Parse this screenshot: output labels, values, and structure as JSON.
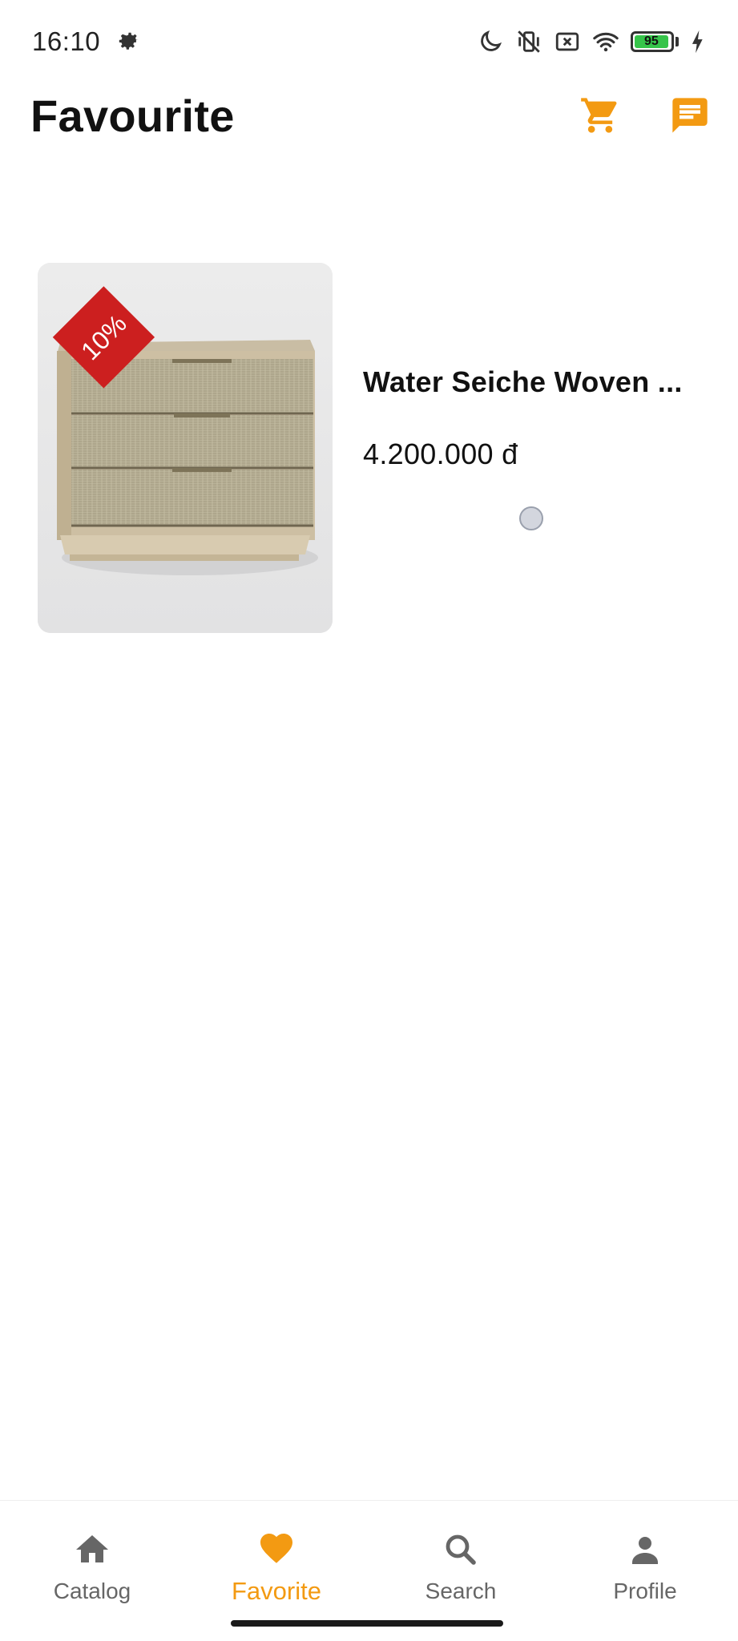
{
  "status_bar": {
    "time": "16:10",
    "battery_level": "95",
    "icons": [
      "gear-icon",
      "moon-icon",
      "vibrate-off-icon",
      "sim-off-icon",
      "wifi-icon",
      "battery-icon",
      "charging-icon"
    ]
  },
  "header": {
    "title": "Favourite",
    "cart_icon": "cart-icon",
    "chat_icon": "message-icon"
  },
  "favourites": [
    {
      "name": "Water Seiche Woven ...",
      "price": "4.200.000 đ",
      "discount": "10%"
    }
  ],
  "bottom_nav": {
    "items": [
      {
        "label": "Catalog",
        "icon": "home-icon",
        "active": false
      },
      {
        "label": "Favorite",
        "icon": "heart-icon",
        "active": true
      },
      {
        "label": "Search",
        "icon": "search-icon",
        "active": false
      },
      {
        "label": "Profile",
        "icon": "person-icon",
        "active": false
      }
    ]
  },
  "colors": {
    "accent": "#f39a12",
    "badge": "#cc1f1f",
    "battery": "#36c44a"
  }
}
